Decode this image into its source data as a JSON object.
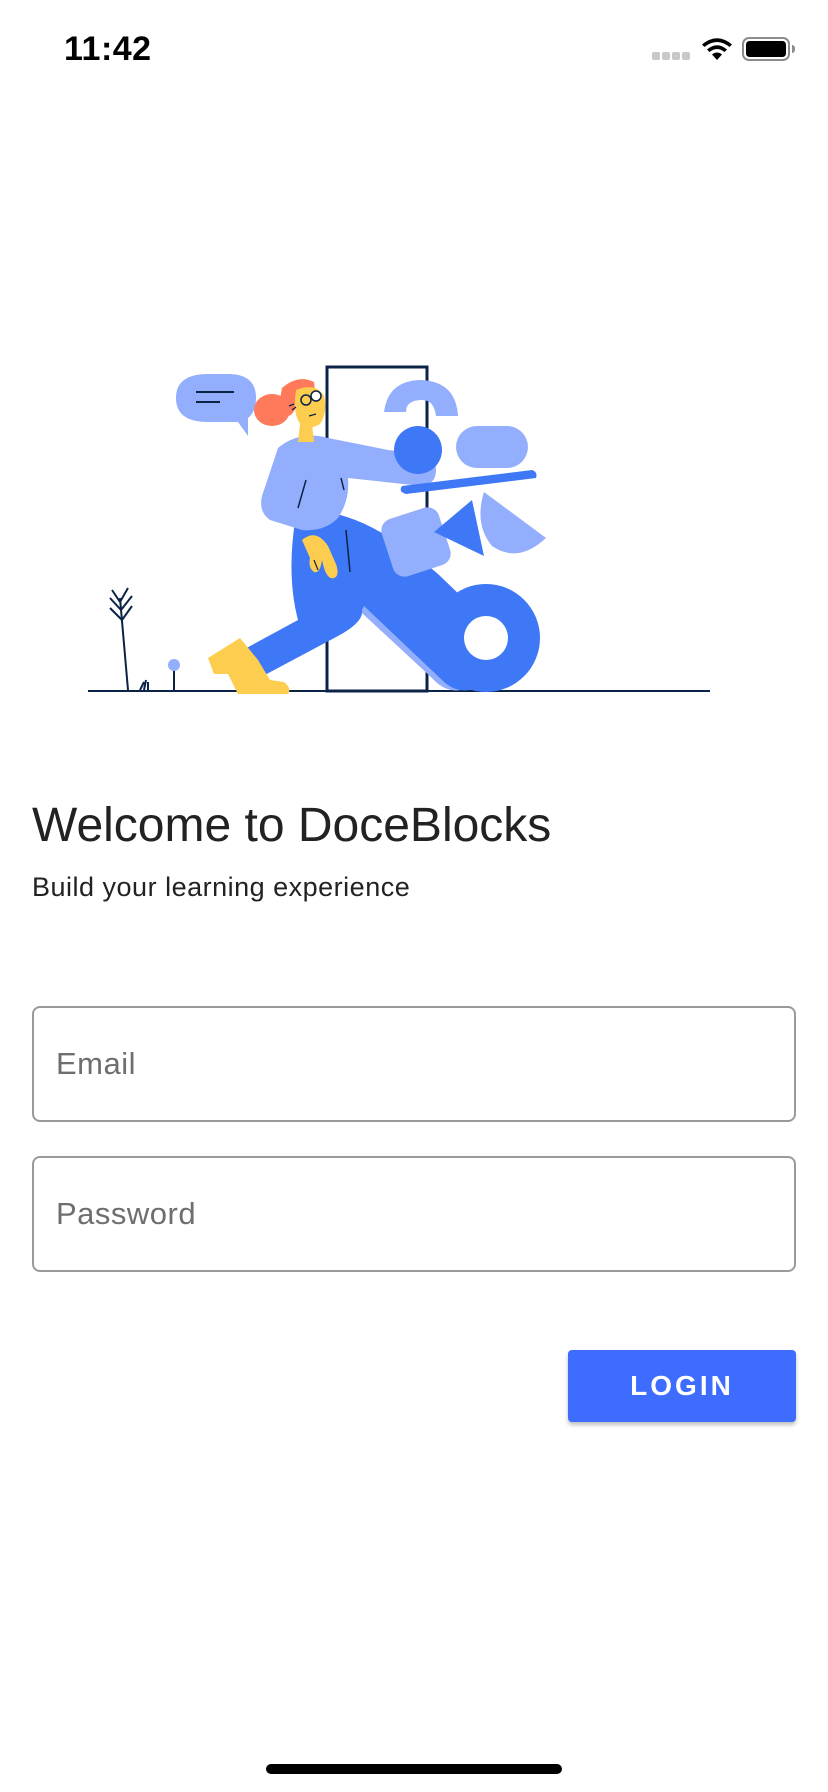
{
  "status_bar": {
    "time": "11:42"
  },
  "illustration": {
    "icon": "person-building-blocks-illustration",
    "colors": {
      "primary_blue": "#3f78f6",
      "light_blue": "#93aefc",
      "yellow": "#fdcd4f",
      "orange": "#ff7a5a",
      "navy": "#0b2346"
    }
  },
  "welcome": {
    "title": "Welcome to DoceBlocks",
    "subtitle": "Build your learning experience"
  },
  "form": {
    "email_placeholder": "Email",
    "email_value": "",
    "password_placeholder": "Password",
    "password_value": "",
    "login_label": "LOGIN"
  },
  "colors": {
    "accent": "#3d6cff",
    "field_border": "#9a9a9a",
    "text": "#222222"
  }
}
